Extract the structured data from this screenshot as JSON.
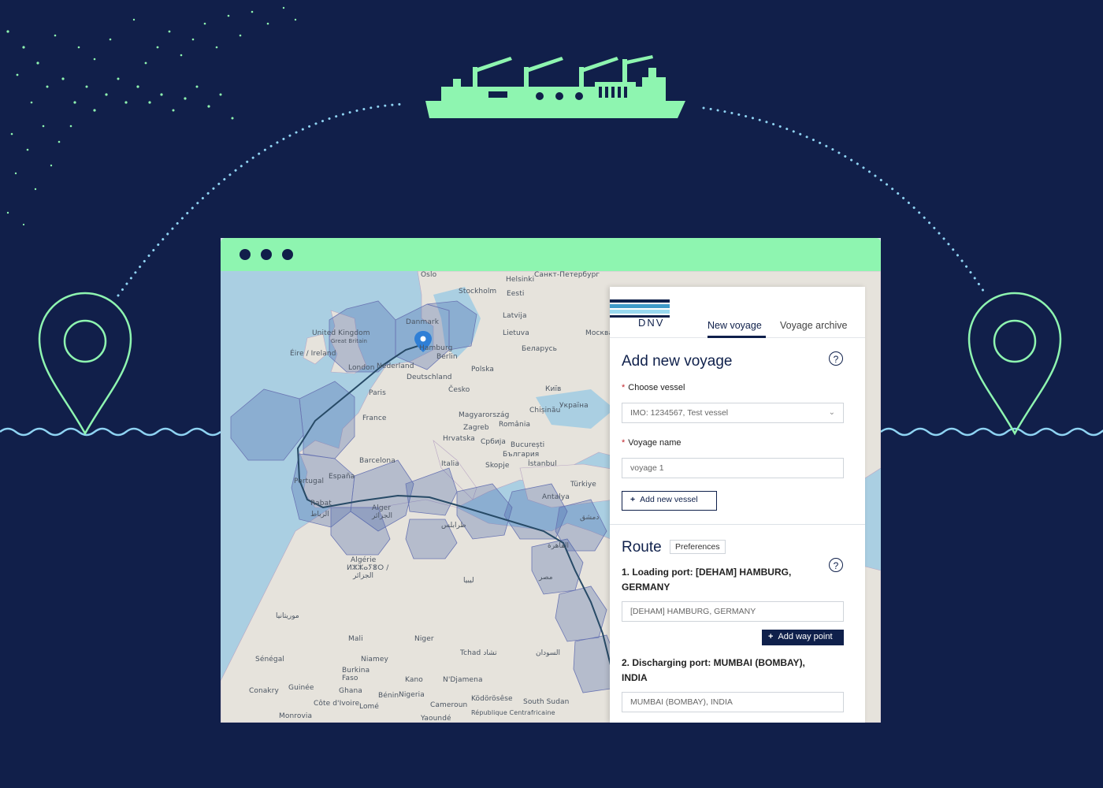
{
  "browser": {
    "dots": [
      "dot-1",
      "dot-2",
      "dot-3"
    ]
  },
  "map": {
    "labels": [
      {
        "text": "Oslo"
      },
      {
        "text": "Helsinki"
      },
      {
        "text": "Санкт-Петербург"
      },
      {
        "text": "Stockholm"
      },
      {
        "text": "Eesti"
      },
      {
        "text": "Latvija"
      },
      {
        "text": "Lietuva"
      },
      {
        "text": "Москва"
      },
      {
        "text": "Danmark"
      },
      {
        "text": "Беларусь"
      },
      {
        "text": "United Kingdom"
      },
      {
        "text": "Great Britain"
      },
      {
        "text": "Éire / Ireland"
      },
      {
        "text": "London"
      },
      {
        "text": "Nederland"
      },
      {
        "text": "Berlin"
      },
      {
        "text": "Polska"
      },
      {
        "text": "Hamburg"
      },
      {
        "text": "Deutschland"
      },
      {
        "text": "Paris"
      },
      {
        "text": "Česko"
      },
      {
        "text": "Київ"
      },
      {
        "text": "France"
      },
      {
        "text": "Україна"
      },
      {
        "text": "Magyarország"
      },
      {
        "text": "Chișinău"
      },
      {
        "text": "Zagreb"
      },
      {
        "text": "România"
      },
      {
        "text": "Hrvatska"
      },
      {
        "text": "Србија"
      },
      {
        "text": "București"
      },
      {
        "text": "България"
      },
      {
        "text": "Barcelona"
      },
      {
        "text": "Italia"
      },
      {
        "text": "Skopje"
      },
      {
        "text": "España"
      },
      {
        "text": "İstanbul"
      },
      {
        "text": "Portugal"
      },
      {
        "text": "Türkiye"
      },
      {
        "text": "Antalya"
      },
      {
        "text": "Rabat"
      },
      {
        "text": "Alger"
      },
      {
        "text": "الرباط"
      },
      {
        "text": "الجزائر"
      },
      {
        "text": "طرابلس"
      },
      {
        "text": "دمشق"
      },
      {
        "text": "القاهرة"
      },
      {
        "text": "Algérie"
      },
      {
        "text": "ⵍⵣⵣⴰⵢⴻⵔ /"
      },
      {
        "text": "الجزائر"
      },
      {
        "text": "ليبيا"
      },
      {
        "text": "مصر"
      },
      {
        "text": "موريتانيا"
      },
      {
        "text": "Mali"
      },
      {
        "text": "Niger"
      },
      {
        "text": "Tchad تشاد"
      },
      {
        "text": "السودان"
      },
      {
        "text": "Sénégal"
      },
      {
        "text": "Niamey"
      },
      {
        "text": "Burkina Faso"
      },
      {
        "text": "Kano"
      },
      {
        "text": "N'Djamena"
      },
      {
        "text": "Nigeria"
      },
      {
        "text": "Conakry"
      },
      {
        "text": "Guinée"
      },
      {
        "text": "Côte d'Ivoire"
      },
      {
        "text": "Lomé"
      },
      {
        "text": "Cameroun"
      },
      {
        "text": "Ködörösêse"
      },
      {
        "text": "South Sudan"
      },
      {
        "text": "Yaoundé"
      },
      {
        "text": "Monrovia"
      },
      {
        "text": "République Centrafricaine"
      },
      {
        "text": "Bénin"
      },
      {
        "text": "Ghana"
      }
    ]
  },
  "panel": {
    "logo_text": "DNV",
    "tabs": [
      {
        "label": "New voyage",
        "active": true
      },
      {
        "label": "Voyage archive",
        "active": false
      }
    ],
    "title": "Add new voyage",
    "help_glyph": "?",
    "vessel": {
      "label": "Choose vessel",
      "value": "IMO: 1234567, Test vessel"
    },
    "voyage_name": {
      "label": "Voyage name",
      "value": "voyage 1"
    },
    "add_vessel_label": "Add new vessel",
    "route": {
      "title": "Route",
      "preferences_label": "Preferences",
      "loading_port_label": "1. Loading port: [DEHAM] HAMBURG, GERMANY",
      "loading_port_value": "[DEHAM] HAMBURG, GERMANY",
      "add_way_point_label": "Add way point",
      "discharging_port_label": "2. Discharging port: MUMBAI (BOMBAY), INDIA",
      "discharging_port_value": "MUMBAI (BOMBAY), INDIA"
    }
  },
  "colors": {
    "background": "#111f4a",
    "accent_green": "#8ef5b0",
    "wave_blue": "#8fd3f2",
    "brand_navy": "#0f204b"
  }
}
